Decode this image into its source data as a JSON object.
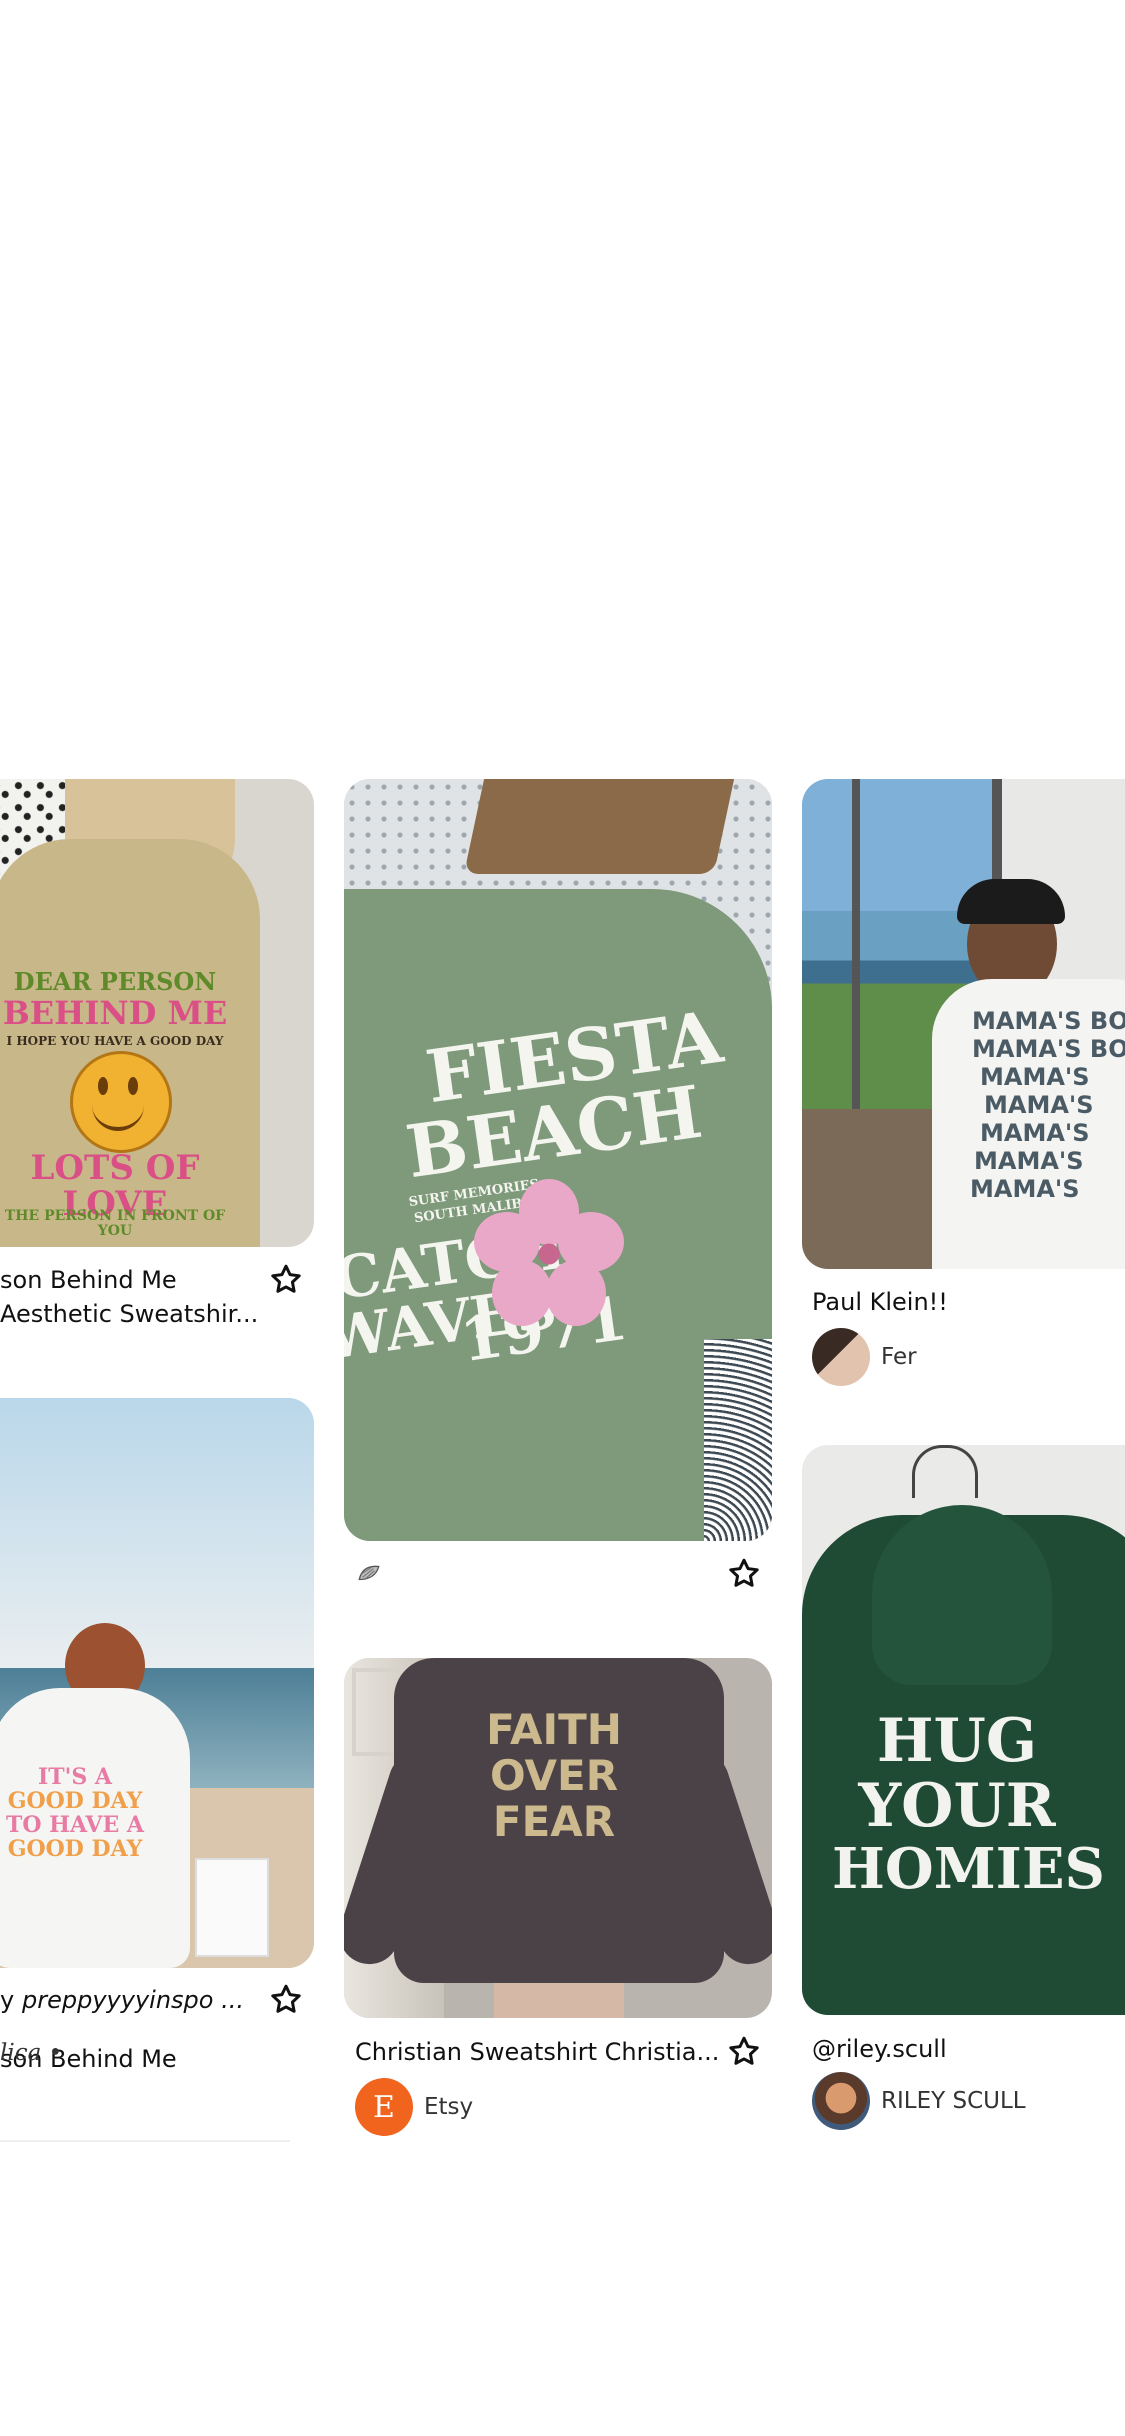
{
  "pins": {
    "dear_person": {
      "caption_line1": "son Behind Me",
      "caption_line2": "Aesthetic Sweatshir...",
      "print": {
        "line1": "DEAR PERSON",
        "line2": "BEHIND ME",
        "line3": "I HOPE YOU HAVE A GOOD DAY",
        "line4": "LOTS OF LOVE",
        "line5": "THE PERSON IN FRONT OF YOU"
      }
    },
    "fiesta_beach": {
      "print": {
        "line1": "FIESTA",
        "line2": "BEACH",
        "line3": "SURF MEMORIES",
        "line4": "SOUTH MALIBU",
        "line5": "CATCH",
        "line6": "WAVES",
        "line7": "1971"
      }
    },
    "mamas_boy": {
      "caption": "Paul Klein!!",
      "user": "Fer",
      "print": {
        "line1": "MAMA'S BOY",
        "line2": "MAMA'S BOY",
        "line3": "MAMA'S",
        "line4": "MAMA'S",
        "line5": "MAMA'S",
        "line6": "MAMA'S",
        "line7": "MAMA'S"
      }
    },
    "good_day": {
      "caption": "preppyyyyinspo ...",
      "user": "lica •",
      "print": {
        "line1": "IT'S A",
        "line2": "GOOD DAY",
        "line3": "TO HAVE A",
        "line4": "GOOD DAY"
      }
    },
    "faith_over_fear": {
      "caption": "Christian Sweatshirt Christia...",
      "user": "Etsy",
      "avatar_letter": "E",
      "print": {
        "line1": "FAITH",
        "line2": "OVER",
        "line3": "FEAR"
      }
    },
    "hug_your_homies": {
      "caption": "@riley.scull",
      "user": "RILEY SCULL",
      "print": {
        "line1": "HUG",
        "line2": "YOUR",
        "line3": "HOMIES"
      }
    }
  },
  "colors": {
    "etsy": "#F1641E",
    "sage": "#7e9a7b",
    "forest": "#1f4a34",
    "charcoal": "#4a4246",
    "tan": "#cdb98e"
  },
  "icons": {
    "save": "star-outline-icon",
    "source": "shell-icon"
  }
}
